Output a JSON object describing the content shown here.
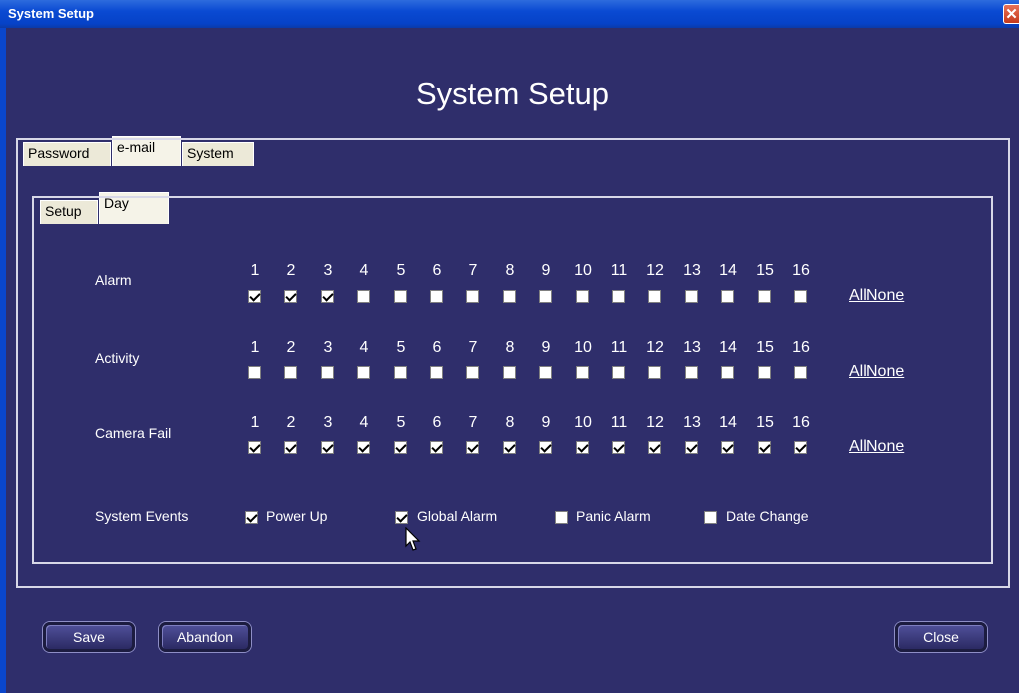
{
  "window": {
    "title": "System Setup",
    "close_glyph": "✕"
  },
  "page_title": "System Setup",
  "tabs": [
    {
      "label": "Password",
      "active": false
    },
    {
      "label": "e-mail",
      "active": true
    },
    {
      "label": "System",
      "active": false
    }
  ],
  "subtabs": [
    {
      "label": "Setup",
      "active": false
    },
    {
      "label": "Day",
      "active": true
    }
  ],
  "channel_numbers": [
    "1",
    "2",
    "3",
    "4",
    "5",
    "6",
    "7",
    "8",
    "9",
    "10",
    "11",
    "12",
    "13",
    "14",
    "15",
    "16"
  ],
  "rows": [
    {
      "label": "Alarm",
      "checked": [
        true,
        true,
        true,
        false,
        false,
        false,
        false,
        false,
        false,
        false,
        false,
        false,
        false,
        false,
        false,
        false
      ]
    },
    {
      "label": "Activity",
      "checked": [
        false,
        false,
        false,
        false,
        false,
        false,
        false,
        false,
        false,
        false,
        false,
        false,
        false,
        false,
        false,
        false
      ]
    },
    {
      "label": "Camera Fail",
      "checked": [
        true,
        true,
        true,
        true,
        true,
        true,
        true,
        true,
        true,
        true,
        true,
        true,
        true,
        true,
        true,
        true
      ]
    }
  ],
  "links": {
    "all": "All",
    "none": "None"
  },
  "system_events": {
    "label": "System Events",
    "items": [
      {
        "label": "Power Up",
        "checked": true
      },
      {
        "label": "Global Alarm",
        "checked": true
      },
      {
        "label": "Panic Alarm",
        "checked": false
      },
      {
        "label": "Date Change",
        "checked": false
      }
    ]
  },
  "buttons": {
    "save": "Save",
    "abandon": "Abandon",
    "close": "Close"
  },
  "icons": {
    "close": "close-icon",
    "cursor": "mouse-pointer-icon"
  },
  "colors": {
    "background": "#2f2e6b",
    "titlebar": "#0a4ad2",
    "tab_bg": "#ece9d8",
    "text": "#ffffff"
  }
}
